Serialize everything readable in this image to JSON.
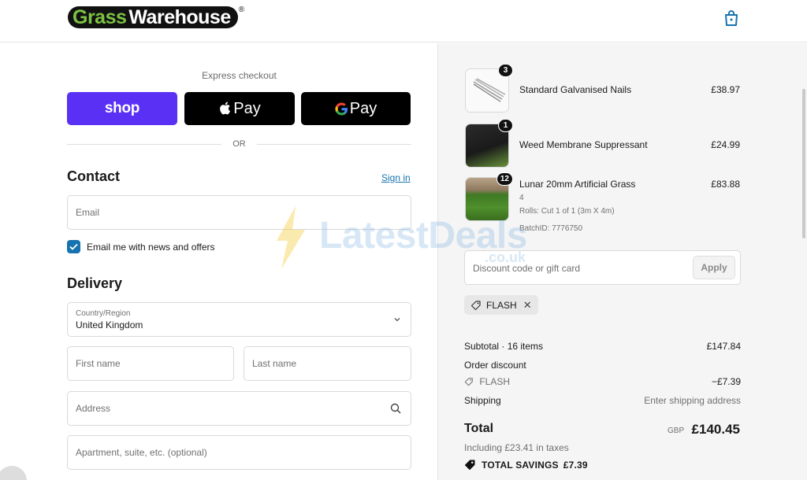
{
  "header": {
    "logo": {
      "part1": "Grass",
      "part2": "Warehouse",
      "reg": "®"
    },
    "cart_icon": "shopping-bag-icon"
  },
  "express": {
    "label": "Express checkout",
    "shop_label": "shop",
    "apple_label": "Pay",
    "gpay_label": "Pay",
    "or_label": "OR"
  },
  "contact": {
    "title": "Contact",
    "signin_label": "Sign in",
    "email_placeholder": "Email",
    "newsletter_label": "Email me with news and offers",
    "newsletter_checked": true
  },
  "delivery": {
    "title": "Delivery",
    "country_label": "Country/Region",
    "country_value": "United Kingdom",
    "first_name_placeholder": "First name",
    "last_name_placeholder": "Last name",
    "address_placeholder": "Address",
    "apartment_placeholder": "Apartment, suite, etc. (optional)"
  },
  "order": {
    "items": [
      {
        "name": "Standard Galvanised Nails",
        "qty": "3",
        "price": "£38.97"
      },
      {
        "name": "Weed Membrane Suppressant",
        "qty": "1",
        "price": "£24.99"
      },
      {
        "name": "Lunar 20mm Artificial Grass",
        "qty": "12",
        "price": "£83.88",
        "sub1": "4",
        "sub2": "Rolls: Cut 1 of 1 (3m X 4m)",
        "sub3": "BatchID: 7776750"
      }
    ],
    "discount_placeholder": "Discount code or gift card",
    "apply_label": "Apply",
    "applied_code": "FLASH",
    "subtotal_label": "Subtotal · 16 items",
    "subtotal_value": "£147.84",
    "order_discount_label": "Order discount",
    "discount_code_label": "FLASH",
    "discount_value": "−£7.39",
    "shipping_label": "Shipping",
    "shipping_value": "Enter shipping address",
    "total_label": "Total",
    "currency": "GBP",
    "total_value": "£140.45",
    "taxes_label": "Including £23.41 in taxes",
    "savings_label": "TOTAL SAVINGS",
    "savings_value": "£7.39"
  },
  "watermark": {
    "text": "LatestDeals",
    "sub": ".co.uk"
  },
  "colors": {
    "shop": "#5a31f4",
    "link": "#1773b0",
    "logo_green": "#7cc242"
  }
}
